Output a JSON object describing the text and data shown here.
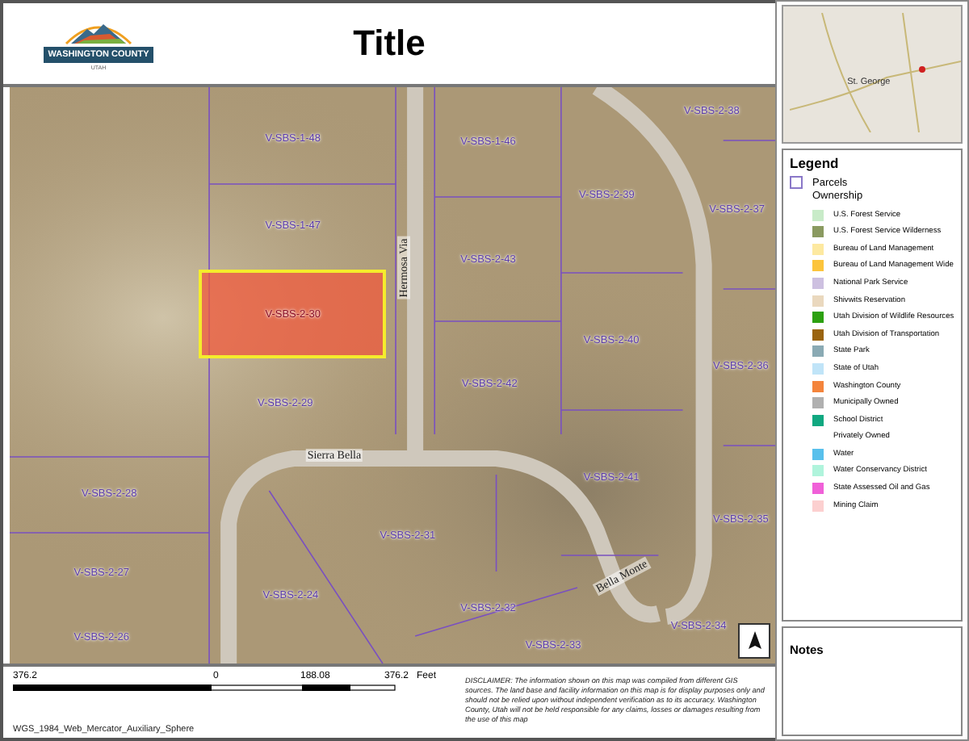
{
  "header": {
    "logo": {
      "name": "WASHINGTON COUNTY",
      "sub": "UTAH"
    },
    "title": "Title"
  },
  "map": {
    "labels": [
      {
        "text": "V-SBS-2-38",
        "kind": "parcel",
        "selected": false
      },
      {
        "text": "V-SBS-1-48",
        "kind": "parcel",
        "selected": false
      },
      {
        "text": "V-SBS-1-46",
        "kind": "parcel",
        "selected": false
      },
      {
        "text": "V-SBS-2-39",
        "kind": "parcel",
        "selected": false
      },
      {
        "text": "V-SBS-2-37",
        "kind": "parcel",
        "selected": false
      },
      {
        "text": "V-SBS-1-47",
        "kind": "parcel",
        "selected": false
      },
      {
        "text": "V-SBS-2-43",
        "kind": "parcel",
        "selected": false
      },
      {
        "text": "Hermosa Via",
        "kind": "street-vertical"
      },
      {
        "text": "V-SBS-2-30",
        "kind": "parcel",
        "selected": true
      },
      {
        "text": "V-SBS-2-40",
        "kind": "parcel",
        "selected": false
      },
      {
        "text": "V-SBS-2-36",
        "kind": "parcel",
        "selected": false
      },
      {
        "text": "V-SBS-2-42",
        "kind": "parcel",
        "selected": false
      },
      {
        "text": "V-SBS-2-29",
        "kind": "parcel",
        "selected": false
      },
      {
        "text": "Sierra Bella",
        "kind": "street"
      },
      {
        "text": "V-SBS-2-41",
        "kind": "parcel",
        "selected": false
      },
      {
        "text": "V-SBS-2-28",
        "kind": "parcel",
        "selected": false
      },
      {
        "text": "V-SBS-2-35",
        "kind": "parcel",
        "selected": false
      },
      {
        "text": "V-SBS-2-31",
        "kind": "parcel",
        "selected": false
      },
      {
        "text": "V-SBS-2-27",
        "kind": "parcel",
        "selected": false
      },
      {
        "text": "Bella Monte",
        "kind": "street-diagonal"
      },
      {
        "text": "V-SBS-2-24",
        "kind": "parcel",
        "selected": false
      },
      {
        "text": "V-SBS-2-32",
        "kind": "parcel",
        "selected": false
      },
      {
        "text": "V-SBS-2-34",
        "kind": "parcel",
        "selected": false
      },
      {
        "text": "V-SBS-2-26",
        "kind": "parcel",
        "selected": false
      },
      {
        "text": "V-SBS-2-33",
        "kind": "parcel",
        "selected": false
      }
    ]
  },
  "scale": {
    "ticks": [
      "376.2",
      "0",
      "188.08",
      "376.2"
    ],
    "unit": "Feet",
    "projection": "WGS_1984_Web_Mercator_Auxiliary_Sphere"
  },
  "disclaimer": "DISCLAIMER: The information shown on this map was compiled from different GIS sources. The land base and facility information on this map is for display purposes only and should not be relied upon without independent verification as to its accuracy. Washington County, Utah will not be held responsible for any claims, losses or damages resulting from the use of this map",
  "locator": {
    "place": "St. George"
  },
  "legend": {
    "title": "Legend",
    "parcels": "Parcels",
    "group": "Ownership",
    "items": [
      {
        "label": "U.S. Forest Service",
        "color": "#c8ebc8"
      },
      {
        "label": "U.S. Forest Service Wilderness",
        "color": "#8a9a60"
      },
      {
        "label": "Bureau of Land Management",
        "color": "#fde9a0"
      },
      {
        "label": "Bureau of Land Management Wide",
        "color": "#fcc43c"
      },
      {
        "label": "National Park Service",
        "color": "#cdc0e0"
      },
      {
        "label": "Shivwits Reservation",
        "color": "#ead8be"
      },
      {
        "label": "Utah Division of Wildlife Resources",
        "color": "#2ca010"
      },
      {
        "label": "Utah Division of Transportation",
        "color": "#9a6410"
      },
      {
        "label": "State Park",
        "color": "#8aaab4"
      },
      {
        "label": "State of Utah",
        "color": "#c0e4f8"
      },
      {
        "label": "Washington County",
        "color": "#f4843c"
      },
      {
        "label": "Municipally Owned",
        "color": "#b0b0b0"
      },
      {
        "label": "School District",
        "color": "#10a880"
      },
      {
        "label": "Privately Owned"
      },
      {
        "label": "Water",
        "color": "#58c0ec"
      },
      {
        "label": "Water Conservancy District",
        "color": "#b0f4dc"
      },
      {
        "label": "State Assessed Oil and Gas",
        "color": "#f060d8"
      },
      {
        "label": "Mining Claim",
        "color": "#fcd0d0"
      }
    ]
  },
  "notes": {
    "title": "Notes"
  }
}
